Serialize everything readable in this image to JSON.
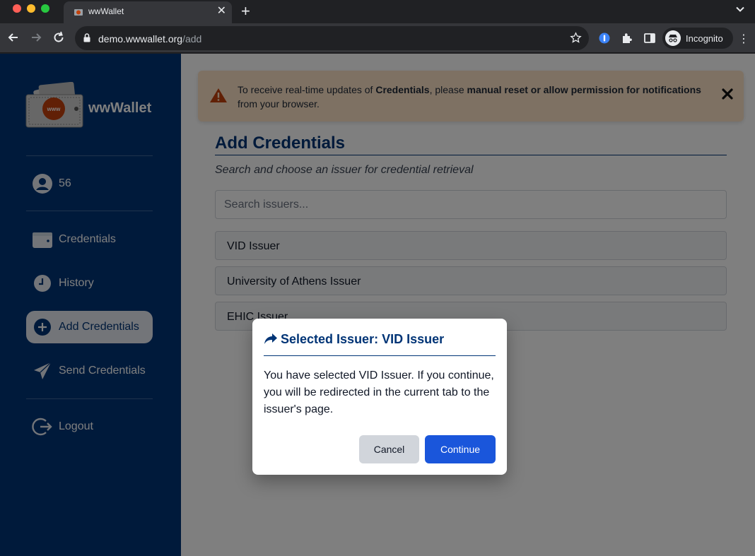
{
  "browser": {
    "tab_title": "wwWallet",
    "url_host": "demo.wwwallet.org",
    "url_path": "/add",
    "profile_label": "Incognito"
  },
  "sidebar": {
    "brand_name": "wwWallet",
    "brand_logo_text": "www",
    "user_id": "56",
    "items": [
      {
        "label": "Credentials",
        "icon": "wallet-icon"
      },
      {
        "label": "History",
        "icon": "clock-icon"
      },
      {
        "label": "Add Credentials",
        "icon": "plus-circle-icon",
        "active": true
      },
      {
        "label": "Send Credentials",
        "icon": "paper-plane-icon"
      }
    ],
    "logout_label": "Logout"
  },
  "alert": {
    "text_prefix": "To receive real-time updates of ",
    "text_bold_1": "Credentials",
    "text_middle": ", please ",
    "text_bold_2": "manual reset or allow permission for notifications",
    "text_suffix": " from your browser."
  },
  "main": {
    "title": "Add Credentials",
    "subtitle": "Search and choose an issuer for credential retrieval",
    "search_placeholder": "Search issuers...",
    "issuers": [
      "VID Issuer",
      "University of Athens Issuer",
      "EHIC Issuer"
    ]
  },
  "modal": {
    "title": "Selected Issuer: VID Issuer",
    "body": "You have selected VID Issuer. If you continue, you will be redirected in the current tab to the issuer's page.",
    "cancel_label": "Cancel",
    "continue_label": "Continue"
  },
  "colors": {
    "sidebar_bg": "#003476",
    "primary_button": "#1a56db",
    "alert_bg": "#fde3c7",
    "warning_icon": "#c2410c"
  }
}
